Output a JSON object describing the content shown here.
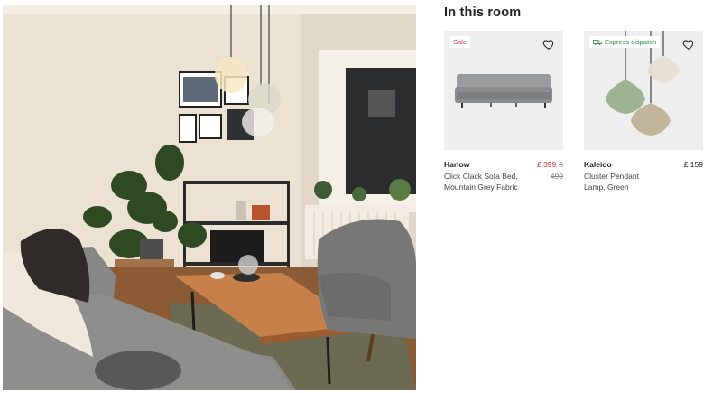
{
  "section": {
    "title": "In this room"
  },
  "products": [
    {
      "badge": "Sale",
      "brand": "Harlow",
      "desc_line1": "Click Clack Sofa Bed,",
      "desc_line2": "Mountain Grey Fabric",
      "price": "£ 399",
      "was_currency": "£",
      "was_price": "499"
    },
    {
      "badge": "Express dispatch",
      "brand": "Kaleido",
      "desc_line1": "Cluster Pendant",
      "desc_line2": "Lamp, Green",
      "price": "£ 159"
    }
  ],
  "colors": {
    "sale_red": "#d4302f",
    "express_green": "#2c8a4e",
    "thumb_bg": "#eeeeee"
  }
}
